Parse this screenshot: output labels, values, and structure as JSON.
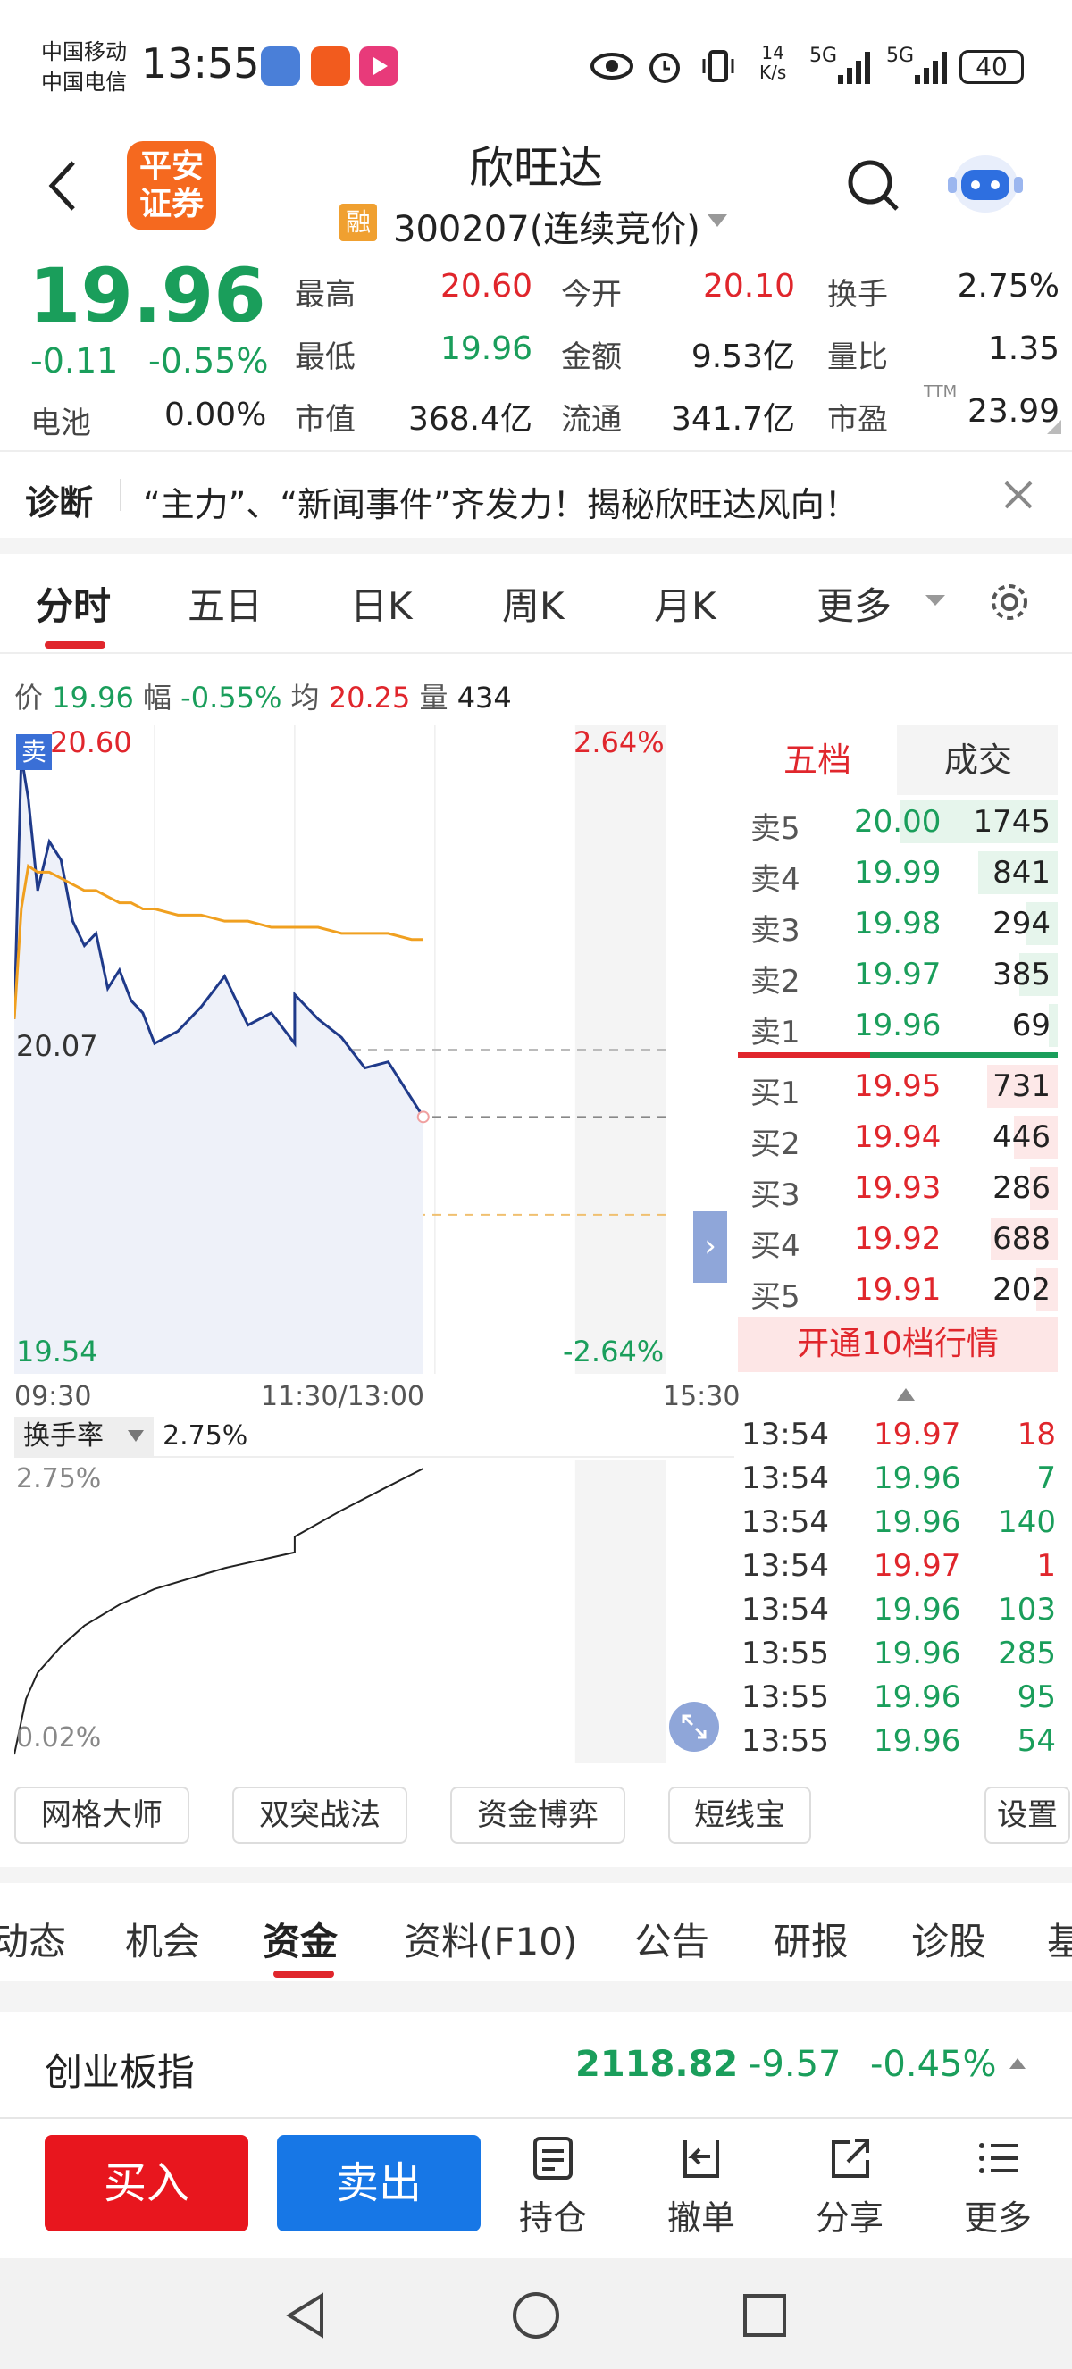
{
  "status_bar": {
    "carrier1": "中国移动",
    "carrier2": "中国电信",
    "time": "13:55",
    "net_speed_top": "14",
    "net_speed_bottom": "K/s",
    "signal1": "5G",
    "signal2": "5G",
    "battery": "40"
  },
  "header": {
    "broker_logo": "平安证券",
    "title": "欣旺达",
    "margin_badge": "融",
    "code": "300207",
    "status": "(连续竞价)",
    "back_icon": "back-arrow",
    "search_icon": "search",
    "assistant_icon": "robot"
  },
  "quote": {
    "price": "19.96",
    "change": "-0.11",
    "change_pct": "-0.55%",
    "sector_label": "电池",
    "sector_pct": "0.00%",
    "fields": [
      {
        "label": "最高",
        "value": "20.60"
      },
      {
        "label": "今开",
        "value": "20.10"
      },
      {
        "label": "换手",
        "value": "2.75%"
      },
      {
        "label": "最低",
        "value": "19.96"
      },
      {
        "label": "金额",
        "value": "9.53亿"
      },
      {
        "label": "量比",
        "value": "1.35"
      },
      {
        "label": "市值",
        "value": "368.4亿"
      },
      {
        "label": "流通",
        "value": "341.7亿"
      },
      {
        "label": "市盈",
        "value": "23.99"
      }
    ],
    "ttm": "TTM"
  },
  "diagnosis": {
    "label": "诊断",
    "text": "“主力”、“新闻事件”齐发力！揭秘欣旺达风向！"
  },
  "chart_tabs": [
    "分时",
    "五日",
    "日K",
    "周K",
    "月K",
    "更多"
  ],
  "chart_info": {
    "price_label": "价",
    "price": "19.96",
    "range_label": "幅",
    "range": "-0.55%",
    "avg_label": "均",
    "avg": "20.25",
    "vol_label": "量",
    "vol": "434"
  },
  "intraday": {
    "sell_marker": "卖",
    "top_price": "20.60",
    "top_pct": "2.64%",
    "mid_price": "20.07",
    "bottom_price": "19.54",
    "bottom_pct": "-2.64%",
    "time_start": "09:30",
    "time_mid": "11:30/13:00",
    "time_end": "15:30"
  },
  "chart_data": [
    {
      "type": "line",
      "x": [
        "09:30",
        "09:33",
        "09:36",
        "09:40",
        "09:45",
        "09:50",
        "09:55",
        "10:00",
        "10:05",
        "10:10",
        "10:15",
        "10:20",
        "10:25",
        "10:30",
        "10:40",
        "10:50",
        "11:00",
        "11:10",
        "11:20",
        "11:30",
        "13:00",
        "13:10",
        "13:20",
        "13:30",
        "13:40",
        "13:50",
        "13:55"
      ],
      "series": [
        {
          "values": [
            20.12,
            20.55,
            20.48,
            20.33,
            20.41,
            20.38,
            20.28,
            20.24,
            20.26,
            20.17,
            20.2,
            20.15,
            20.13,
            20.08,
            20.1,
            20.14,
            20.19,
            20.11,
            20.13,
            20.08,
            20.16,
            20.12,
            20.09,
            20.04,
            20.05,
            19.99,
            19.96
          ]
        },
        {
          "values": [
            20.12,
            20.3,
            20.37,
            20.36,
            20.36,
            20.35,
            20.34,
            20.33,
            20.33,
            20.32,
            20.31,
            20.31,
            20.3,
            20.3,
            20.29,
            20.29,
            20.28,
            20.28,
            20.27,
            20.27,
            20.27,
            20.27,
            20.26,
            20.26,
            20.26,
            20.25,
            20.25
          ]
        }
      ],
      "ylim": [
        19.54,
        20.6
      ]
    },
    {
      "type": "line",
      "x": [
        "09:30",
        "09:35",
        "09:40",
        "09:50",
        "10:00",
        "10:15",
        "10:30",
        "11:00",
        "11:30",
        "13:00",
        "13:20",
        "13:40",
        "13:55"
      ],
      "values": [
        0.02,
        0.55,
        0.8,
        1.05,
        1.25,
        1.45,
        1.6,
        1.8,
        1.95,
        2.1,
        2.35,
        2.58,
        2.75
      ],
      "ylim": [
        0.02,
        2.75
      ]
    }
  ],
  "orderbook": {
    "tabs": [
      "五档",
      "成交"
    ],
    "sell": [
      {
        "label": "卖5",
        "price": "20.00",
        "vol": "1745",
        "depth": 0.9
      },
      {
        "label": "卖4",
        "price": "19.99",
        "vol": "841",
        "depth": 0.45
      },
      {
        "label": "卖3",
        "price": "19.98",
        "vol": "294",
        "depth": 0.18
      },
      {
        "label": "卖2",
        "price": "19.97",
        "vol": "385",
        "depth": 0.22
      },
      {
        "label": "卖1",
        "price": "19.96",
        "vol": "69",
        "depth": 0.05
      }
    ],
    "buy": [
      {
        "label": "买1",
        "price": "19.95",
        "vol": "731",
        "depth": 0.4
      },
      {
        "label": "买2",
        "price": "19.94",
        "vol": "446",
        "depth": 0.25
      },
      {
        "label": "买3",
        "price": "19.93",
        "vol": "286",
        "depth": 0.16
      },
      {
        "label": "买4",
        "price": "19.92",
        "vol": "688",
        "depth": 0.38
      },
      {
        "label": "买5",
        "price": "19.91",
        "vol": "202",
        "depth": 0.12
      }
    ],
    "upgrade": "开通10档行情"
  },
  "turnover": {
    "label": "换手率",
    "value": "2.75%",
    "top": "2.75%",
    "bottom": "0.02%"
  },
  "trades": [
    {
      "time": "13:54",
      "price": "19.97",
      "vol": "18",
      "dir": "buy"
    },
    {
      "time": "13:54",
      "price": "19.96",
      "vol": "7",
      "dir": "sell"
    },
    {
      "time": "13:54",
      "price": "19.96",
      "vol": "140",
      "dir": "sell"
    },
    {
      "time": "13:54",
      "price": "19.97",
      "vol": "1",
      "dir": "buy"
    },
    {
      "time": "13:54",
      "price": "19.96",
      "vol": "103",
      "dir": "sell"
    },
    {
      "time": "13:55",
      "price": "19.96",
      "vol": "285",
      "dir": "sell"
    },
    {
      "time": "13:55",
      "price": "19.96",
      "vol": "95",
      "dir": "sell"
    },
    {
      "time": "13:55",
      "price": "19.96",
      "vol": "54",
      "dir": "sell"
    }
  ],
  "tools": [
    "网格大师",
    "双突战法",
    "资金博弈",
    "短线宝",
    "设置"
  ],
  "info_tabs": [
    "动态",
    "机会",
    "资金",
    "资料(F10)",
    "公告",
    "研报",
    "诊股",
    "基"
  ],
  "index_bar": {
    "name": "创业板指",
    "value": "2118.82",
    "change": "-9.57",
    "pct": "-0.45%"
  },
  "bottom_bar": {
    "buy": "买入",
    "sell": "卖出",
    "items": [
      "持仓",
      "撤单",
      "分享",
      "更多"
    ]
  },
  "colors": {
    "up": "#e0262c",
    "down": "#1a9e5b",
    "price_line": "#1f3a8a",
    "avg_line": "#f0a020",
    "buy_button": "#e8161e",
    "sell_button": "#1777e6"
  }
}
